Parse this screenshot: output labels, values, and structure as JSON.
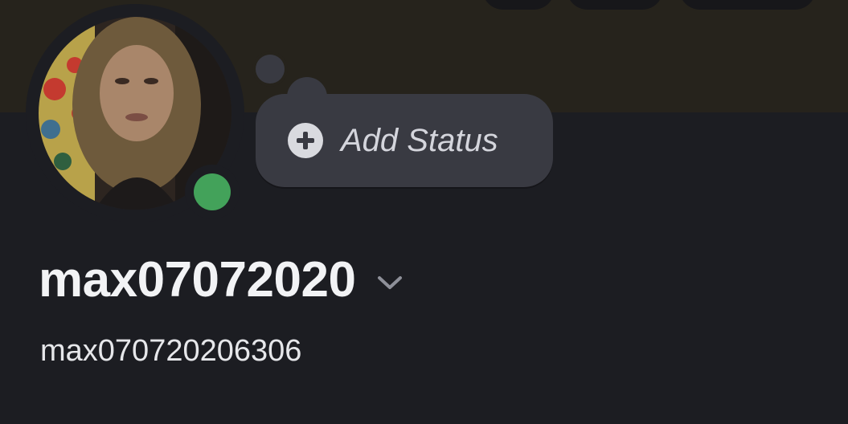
{
  "status": {
    "add_label": "Add Status",
    "indicator_color": "#43a25a"
  },
  "profile": {
    "display_name": "max07072020",
    "username": "max070720206306"
  },
  "icons": {
    "status_add": "plus-circle-icon",
    "expand": "chevron-down-icon"
  }
}
